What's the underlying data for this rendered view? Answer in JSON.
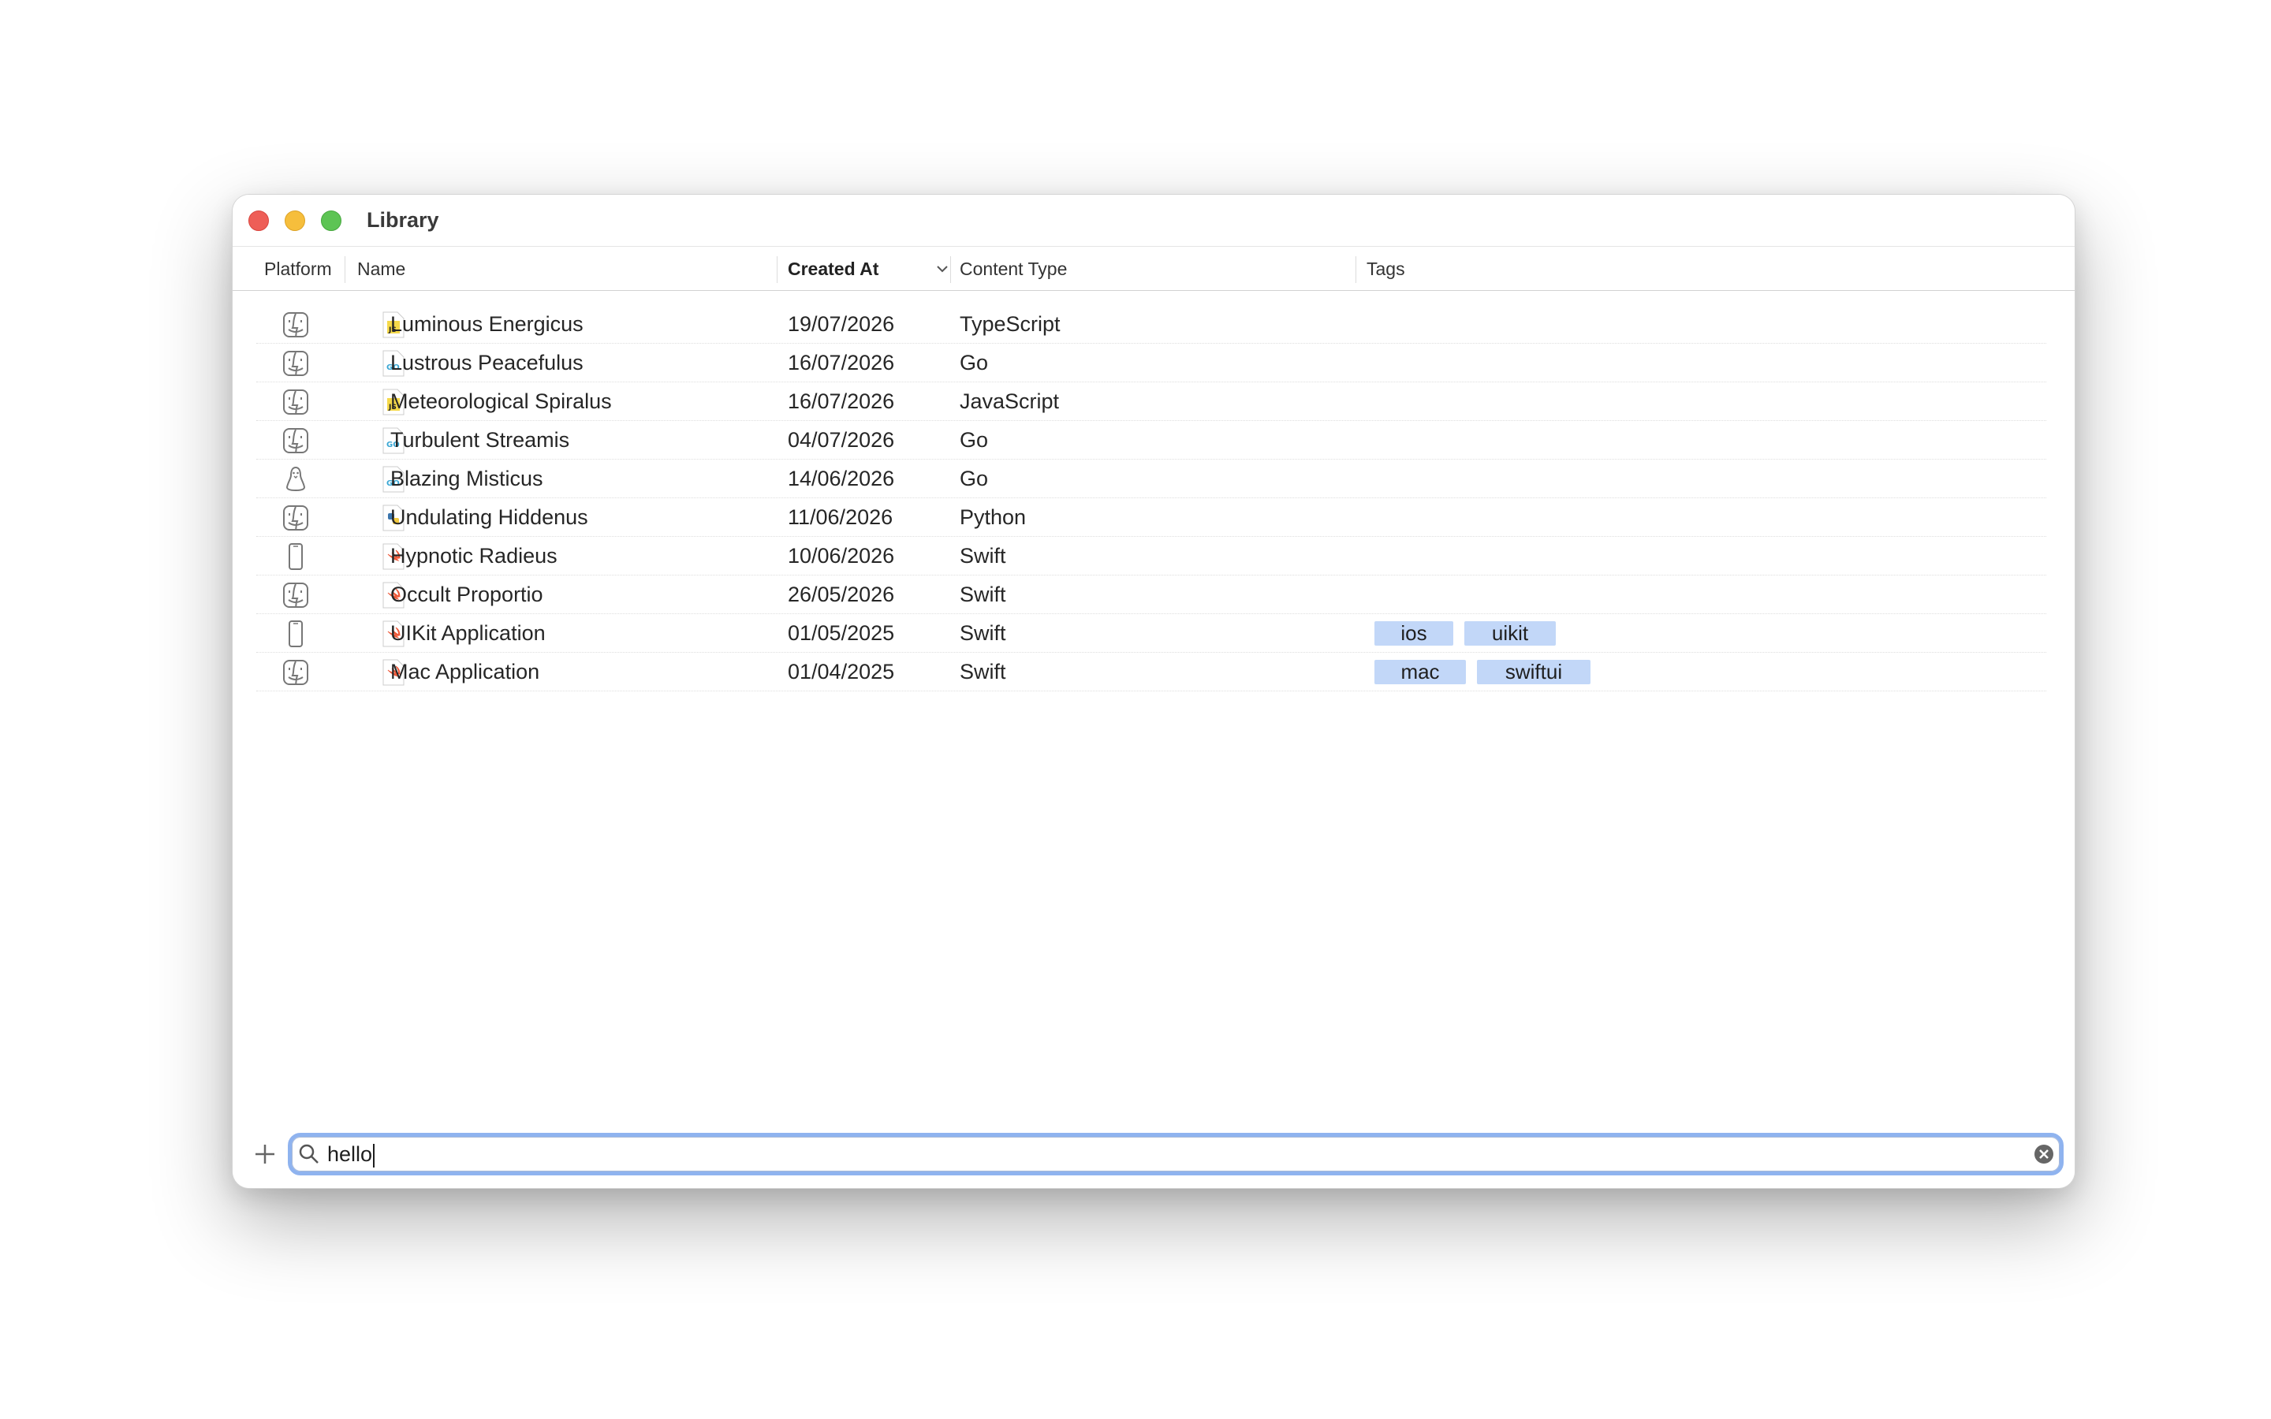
{
  "window": {
    "title": "Library"
  },
  "columns": {
    "platform": "Platform",
    "name": "Name",
    "created_at": "Created At",
    "content_type": "Content Type",
    "tags": "Tags"
  },
  "rows": [
    {
      "platform_icon": "finder-icon",
      "file_icon": "js-file-icon",
      "name": "Luminous Energicus",
      "created_at": "19/07/2026",
      "content_type": "TypeScript",
      "tags": []
    },
    {
      "platform_icon": "finder-icon",
      "file_icon": "go-file-icon",
      "name": "Lustrous Peacefulus",
      "created_at": "16/07/2026",
      "content_type": "Go",
      "tags": []
    },
    {
      "platform_icon": "finder-icon",
      "file_icon": "js-file-icon",
      "name": "Meteorological Spiralus",
      "created_at": "16/07/2026",
      "content_type": "JavaScript",
      "tags": []
    },
    {
      "platform_icon": "finder-icon",
      "file_icon": "go-file-icon",
      "name": "Turbulent Streamis",
      "created_at": "04/07/2026",
      "content_type": "Go",
      "tags": []
    },
    {
      "platform_icon": "linux-penguin-icon",
      "file_icon": "go-file-icon",
      "name": "Blazing Misticus",
      "created_at": "14/06/2026",
      "content_type": "Go",
      "tags": []
    },
    {
      "platform_icon": "finder-icon",
      "file_icon": "python-file-icon",
      "name": "Undulating Hiddenus",
      "created_at": "11/06/2026",
      "content_type": "Python",
      "tags": []
    },
    {
      "platform_icon": "iphone-icon",
      "file_icon": "swift-file-icon",
      "name": "Hypnotic Radieus",
      "created_at": "10/06/2026",
      "content_type": "Swift",
      "tags": []
    },
    {
      "platform_icon": "finder-icon",
      "file_icon": "swift-file-icon",
      "name": "Occult Proportio",
      "created_at": "26/05/2026",
      "content_type": "Swift",
      "tags": []
    },
    {
      "platform_icon": "iphone-icon",
      "file_icon": "swift-file-icon",
      "name": "UIKit Application",
      "created_at": "01/05/2025",
      "content_type": "Swift",
      "tags": [
        "ios",
        "uikit"
      ]
    },
    {
      "platform_icon": "finder-icon",
      "file_icon": "swift-file-icon",
      "name": "Mac Application",
      "created_at": "01/04/2025",
      "content_type": "Swift",
      "tags": [
        "mac",
        "swiftui"
      ]
    }
  ],
  "search": {
    "value": "hello"
  },
  "colors": {
    "tag_bg": "#c2d7f8",
    "focus_ring": "#8fb3ef",
    "close": "#ee5e57",
    "minimize": "#f6be3c",
    "maximize": "#5dc454"
  }
}
